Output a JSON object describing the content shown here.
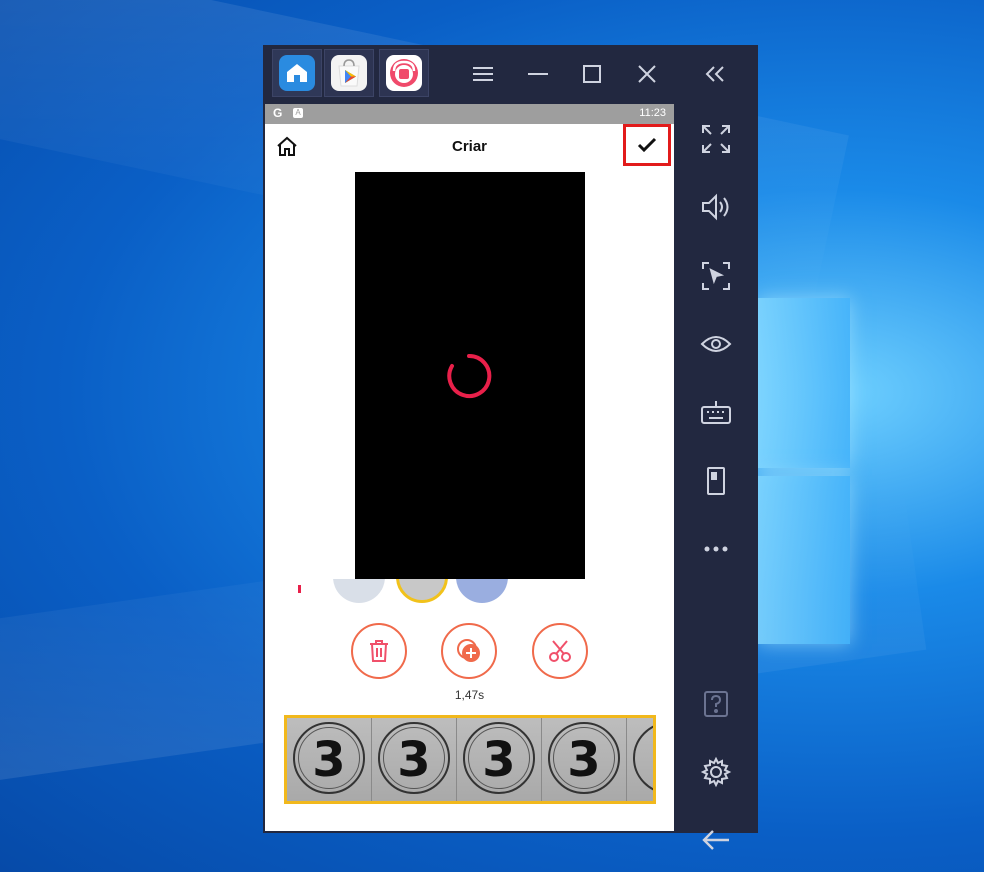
{
  "emulator": {
    "tabs": [
      {
        "name": "home",
        "icon": "home-icon"
      },
      {
        "name": "play-store",
        "icon": "play-store-icon"
      },
      {
        "name": "screen-recorder",
        "icon": "recorder-app-icon"
      }
    ],
    "controls": [
      "menu-icon",
      "minimize-icon",
      "maximize-icon",
      "close-icon",
      "collapse-sidebar-icon"
    ],
    "sidebar": [
      "fullscreen-icon",
      "volume-icon",
      "screen-select-icon",
      "eye-icon",
      "keyboard-icon",
      "device-icon",
      "more-icon",
      "help-icon",
      "settings-icon",
      "back-arrow-icon"
    ]
  },
  "statusbar": {
    "g_label": "G",
    "a_label": "A",
    "time": "11:23"
  },
  "header": {
    "title": "Criar"
  },
  "editor": {
    "duration": "1,47s",
    "frames": [
      "3",
      "3",
      "3",
      "3"
    ]
  },
  "colors": {
    "accent": "#e8204a",
    "highlight_box": "#e21b1b",
    "filmstrip_border": "#f1b81c",
    "emulator_bg": "#222840"
  }
}
